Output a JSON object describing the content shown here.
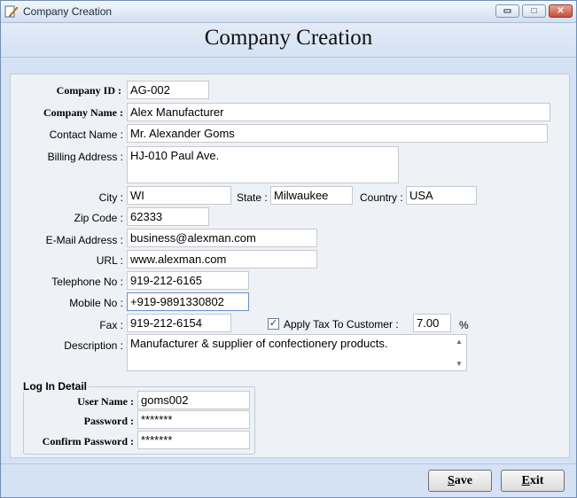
{
  "window": {
    "title": "Company Creation",
    "min_glyph": "▭",
    "max_glyph": "□",
    "close_glyph": "✕"
  },
  "header": {
    "title": "Company Creation"
  },
  "form": {
    "company_id": {
      "label": "Company ID :",
      "value": "AG-002"
    },
    "company_name": {
      "label": "Company Name :",
      "value": "Alex Manufacturer"
    },
    "contact_name": {
      "label": "Contact Name :",
      "value": "Mr. Alexander Goms"
    },
    "billing_address": {
      "label": "Billing Address :",
      "value": "HJ-010 Paul Ave."
    },
    "city": {
      "label": "City :",
      "value": "WI"
    },
    "state": {
      "label": "State :",
      "value": "Milwaukee"
    },
    "country": {
      "label": "Country :",
      "value": "USA"
    },
    "zip_code": {
      "label": "Zip Code :",
      "value": "62333"
    },
    "email": {
      "label": "E-Mail Address :",
      "value": "business@alexman.com"
    },
    "url": {
      "label": "URL :",
      "value": "www.alexman.com"
    },
    "telephone": {
      "label": "Telephone No :",
      "value": "919-212-6165"
    },
    "mobile": {
      "label": "Mobile No :",
      "value": "+919-9891330802"
    },
    "fax": {
      "label": "Fax :",
      "value": "919-212-6154"
    },
    "apply_tax": {
      "label": "Apply Tax To Customer :",
      "checked": true,
      "value": "7.00",
      "unit": "%"
    },
    "description": {
      "label": "Description :",
      "value": "Manufacturer & supplier of confectionery products."
    }
  },
  "login": {
    "title": "Log In Detail",
    "user_name": {
      "label": "User Name :",
      "value": "goms002"
    },
    "password": {
      "label": "Password :",
      "value": "*******"
    },
    "confirm_password": {
      "label": "Confirm Password :",
      "value": "*******"
    }
  },
  "buttons": {
    "save": {
      "mnemonic": "S",
      "rest": "ave"
    },
    "exit": {
      "mnemonic": "E",
      "rest": "xit"
    }
  },
  "icons": {
    "app": "app-pencil-icon",
    "check": "✓",
    "scroll_up": "▲",
    "scroll_down": "▼"
  }
}
